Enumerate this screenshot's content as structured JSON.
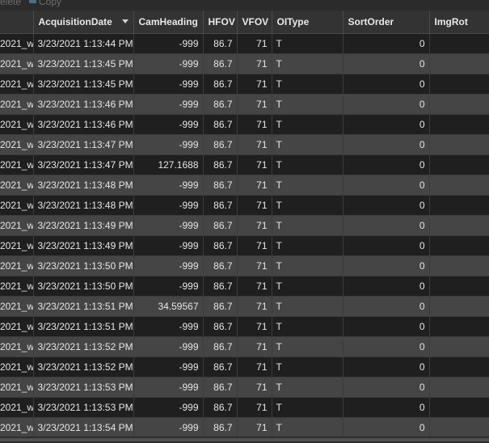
{
  "toolbar": {
    "delete_label": "elete",
    "copy_label": "Copy"
  },
  "table": {
    "columns": [
      "",
      "AcquisitionDate",
      "CamHeading",
      "HFOV",
      "VFOV",
      "OIType",
      "SortOrder",
      "ImgRot"
    ],
    "rows": [
      [
        "2021_w",
        "3/23/2021 1:13:44 PM",
        "-999",
        "86.7",
        "71",
        "T",
        "0",
        ""
      ],
      [
        "2021_w",
        "3/23/2021 1:13:45 PM",
        "-999",
        "86.7",
        "71",
        "T",
        "0",
        ""
      ],
      [
        "2021_w",
        "3/23/2021 1:13:45 PM",
        "-999",
        "86.7",
        "71",
        "T",
        "0",
        ""
      ],
      [
        "2021_w",
        "3/23/2021 1:13:46 PM",
        "-999",
        "86.7",
        "71",
        "T",
        "0",
        ""
      ],
      [
        "2021_w",
        "3/23/2021 1:13:46 PM",
        "-999",
        "86.7",
        "71",
        "T",
        "0",
        ""
      ],
      [
        "2021_w",
        "3/23/2021 1:13:47 PM",
        "-999",
        "86.7",
        "71",
        "T",
        "0",
        ""
      ],
      [
        "2021_w",
        "3/23/2021 1:13:47 PM",
        "127.1688",
        "86.7",
        "71",
        "T",
        "0",
        ""
      ],
      [
        "2021_w",
        "3/23/2021 1:13:48 PM",
        "-999",
        "86.7",
        "71",
        "T",
        "0",
        ""
      ],
      [
        "2021_w",
        "3/23/2021 1:13:48 PM",
        "-999",
        "86.7",
        "71",
        "T",
        "0",
        ""
      ],
      [
        "2021_w",
        "3/23/2021 1:13:49 PM",
        "-999",
        "86.7",
        "71",
        "T",
        "0",
        ""
      ],
      [
        "2021_w",
        "3/23/2021 1:13:49 PM",
        "-999",
        "86.7",
        "71",
        "T",
        "0",
        ""
      ],
      [
        "2021_w",
        "3/23/2021 1:13:50 PM",
        "-999",
        "86.7",
        "71",
        "T",
        "0",
        ""
      ],
      [
        "2021_w",
        "3/23/2021 1:13:50 PM",
        "-999",
        "86.7",
        "71",
        "T",
        "0",
        ""
      ],
      [
        "2021_w",
        "3/23/2021 1:13:51 PM",
        "34.59567",
        "86.7",
        "71",
        "T",
        "0",
        ""
      ],
      [
        "2021_w",
        "3/23/2021 1:13:51 PM",
        "-999",
        "86.7",
        "71",
        "T",
        "0",
        ""
      ],
      [
        "2021_w",
        "3/23/2021 1:13:52 PM",
        "-999",
        "86.7",
        "71",
        "T",
        "0",
        ""
      ],
      [
        "2021_w",
        "3/23/2021 1:13:52 PM",
        "-999",
        "86.7",
        "71",
        "T",
        "0",
        ""
      ],
      [
        "2021_w",
        "3/23/2021 1:13:53 PM",
        "-999",
        "86.7",
        "71",
        "T",
        "0",
        ""
      ],
      [
        "2021_w",
        "3/23/2021 1:13:53 PM",
        "-999",
        "86.7",
        "71",
        "T",
        "0",
        ""
      ],
      [
        "2021_w",
        "3/23/2021 1:13:54 PM",
        "-999",
        "86.7",
        "71",
        "T",
        "0",
        ""
      ]
    ]
  },
  "colors": {
    "header_bg": "#333333",
    "row_dark": "#1f1f1f",
    "row_light": "#454545",
    "text": "#e6e6e6"
  }
}
